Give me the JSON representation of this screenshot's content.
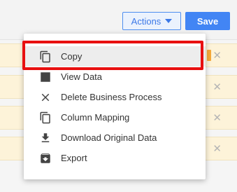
{
  "toolbar": {
    "actions_label": "Actions",
    "save_label": "Save"
  },
  "menu": {
    "items": [
      {
        "label": "Copy",
        "icon": "copy-icon"
      },
      {
        "label": "View Data",
        "icon": "view-data-icon"
      },
      {
        "label": "Delete Business Process",
        "icon": "close-icon"
      },
      {
        "label": "Column Mapping",
        "icon": "copy-icon"
      },
      {
        "label": "Download Original Data",
        "icon": "download-icon"
      },
      {
        "label": "Export",
        "icon": "export-icon"
      }
    ]
  },
  "colors": {
    "accent": "#4285f4",
    "highlight": "#e81010",
    "row_bg": "#fdf3d9"
  }
}
